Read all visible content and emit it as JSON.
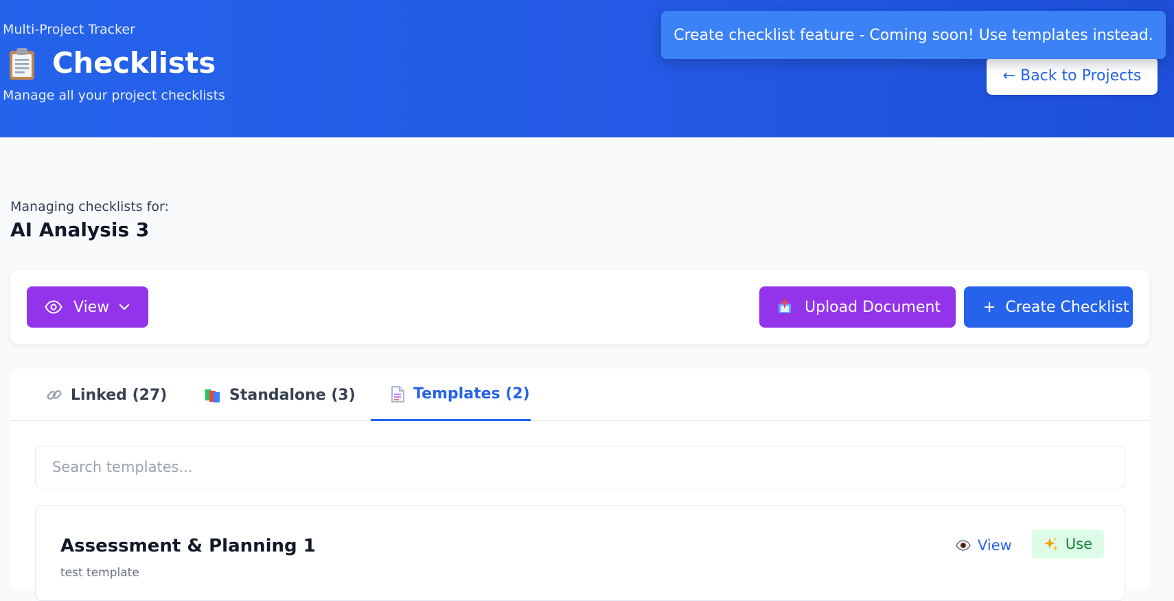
{
  "header": {
    "app_name": "Multi-Project Tracker",
    "title": "Checklists",
    "title_icon": "clipboard-icon",
    "subtitle": "Manage all your project checklists",
    "back_button": "← Back to Projects",
    "background_color": "#2563eb"
  },
  "toast": {
    "message": "Create checklist feature - Coming soon! Use templates instead.",
    "color": "#3b82f6"
  },
  "context": {
    "label": "Managing checklists for:",
    "project": "AI Analysis 3"
  },
  "toolbar": {
    "view_label": "View",
    "view_icon": "eye-icon",
    "upload_label": "Upload Document",
    "upload_icon": "upload-document-icon",
    "create_label": "Create Checklist",
    "create_icon": "plus-icon",
    "purple": "#9333ea",
    "blue": "#2563eb"
  },
  "tabs": [
    {
      "label": "Linked (27)",
      "icon": "link-icon",
      "active": false
    },
    {
      "label": "Standalone (3)",
      "icon": "books-icon",
      "active": false
    },
    {
      "label": "Templates (2)",
      "icon": "template-document-icon",
      "active": true
    }
  ],
  "search": {
    "placeholder": "Search templates...",
    "value": ""
  },
  "templates": [
    {
      "title": "Assessment & Planning 1",
      "subtitle": "test template",
      "view_label": "View",
      "view_icon": "eye-icon",
      "use_label": "Use",
      "use_icon": "sparkles-icon"
    }
  ]
}
